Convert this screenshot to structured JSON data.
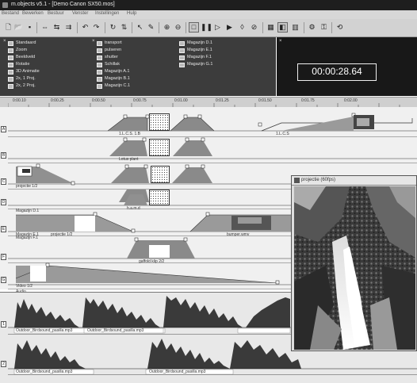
{
  "window": {
    "title": "m.objects v5.1 - [Demo Canon SX50.mos]"
  },
  "menu": [
    "Bestand",
    "Bewerken",
    "Bestuur",
    "Venster",
    "Instellingen",
    "Hulp"
  ],
  "toolbar": {
    "buttons": [
      "new-file-icon",
      "open-icon",
      "save-icon",
      "zoom-in-icon",
      "zoom-out-icon",
      "zoom-fit-icon",
      "undo-icon",
      "redo-icon",
      "loop-icon",
      "sync-icon",
      "cursor-icon",
      "pen-icon",
      "zoom-tool-in-icon",
      "zoom-tool-out-icon",
      "monitor-icon",
      "pause-icon",
      "play-icon",
      "record-icon",
      "lock-icon",
      "grid-icon",
      "timeline-icon",
      "split-icon",
      "settings-icon",
      "wrench-icon",
      "loop2-icon"
    ]
  },
  "objects": {
    "col1": [
      "Standaard",
      "Zoom",
      "Beeldveld",
      "Rotatie",
      "3D Animatie",
      "2x, 1 Proj.",
      "2x, 2 Proj."
    ],
    "col2": [
      "transport",
      "pulseren",
      "shutter",
      "Schillak",
      "Magazijn A.1",
      "Magazijn B.1",
      "Magazijn C.1"
    ],
    "col3": [
      "Magazijn D.1",
      "Magazijn E.1",
      "Magazijn F.1",
      "Magazijn G.1"
    ]
  },
  "timecode": "00:00:28.64",
  "ruler": {
    "ticks": [
      "0:00.10",
      "0:00.25",
      "0:00.50",
      "0:00.75",
      "0:01.00",
      "0:01.25",
      "0:01.50",
      "0:01.75",
      "0:02.00"
    ]
  },
  "tracks": {
    "numbers": [
      "A",
      "B",
      "C",
      "D",
      "E",
      "F",
      "G"
    ],
    "labels": {
      "a_clip": "1.L.C.S. 1.B",
      "a_right": "1.L.C.S",
      "b_clip": "Lotus plant",
      "c_left": "projectie 1/2",
      "d_clip": "h.a.m.d",
      "e_title": "Magazijn D.1",
      "e_left": "Magazijn E.1",
      "e_clip": "projectie 1/2",
      "e_right": "bumper.wmv",
      "f_title": "Magazijn F.1",
      "f_clip": "gaffold klip 2/2",
      "g_left": "Video 1/2",
      "g_bottom": "Audio"
    }
  },
  "audio": {
    "labels": [
      "Outdoor_Birdsound_pasilla.mp3",
      "Outdoor_Birdsound_pasilla.mp3",
      "Outdoor_Birdsound_pasilla.mp3",
      "Outdoor_Birdsound_pasilla.mp3"
    ]
  },
  "projection_window": {
    "title": "projectie (60fps)"
  }
}
